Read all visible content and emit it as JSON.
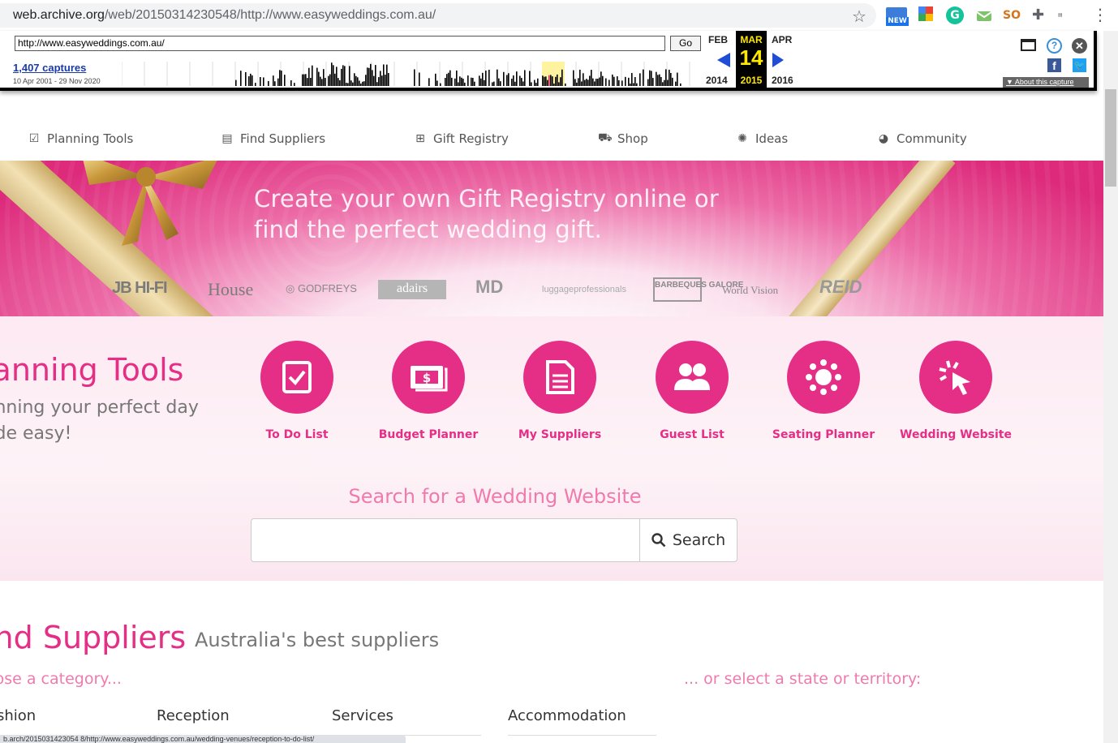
{
  "browser": {
    "url_host": "web.archive.org",
    "url_path": "/web/20150314230548/http://www.easyweddings.com.au/",
    "extensions": [
      "new-badge-icon",
      "google-icon",
      "grammarly-icon",
      "mail-icon",
      "so-icon",
      "puzzle-icon",
      "studio-icon"
    ],
    "new_badge": "NEW",
    "grammarly_letter": "G",
    "so_label": "SO"
  },
  "wayback": {
    "url_value": "http://www.easyweddings.com.au/",
    "go_label": "Go",
    "captures_label": "1,407 captures",
    "date_range": "10 Apr 2001 - 29 Nov 2020",
    "prev_month": "FEB",
    "current_month": "MAR",
    "next_month": "APR",
    "current_day": "14",
    "prev_year": "2014",
    "current_year": "2015",
    "next_year": "2016",
    "about_label": "About this capture",
    "help_glyph": "?",
    "close_glyph": "✕",
    "fb_glyph": "f",
    "tw_glyph": "🐦"
  },
  "nav": {
    "items": [
      {
        "label": "Planning Tools",
        "icon": "checkbox-icon"
      },
      {
        "label": "Find Suppliers",
        "icon": "document-icon"
      },
      {
        "label": "Gift Registry",
        "icon": "gift-icon"
      },
      {
        "label": "Shop",
        "icon": "cart-icon"
      },
      {
        "label": "Ideas",
        "icon": "lightbulb-icon"
      },
      {
        "label": "Community",
        "icon": "chat-icon"
      }
    ]
  },
  "hero": {
    "line1": "Create your own Gift Registry online or",
    "line2": "find the perfect wedding gift.",
    "logos": {
      "jb": "JB HI-FI",
      "house": "House",
      "godfreys": "◎ GODFREYS",
      "adairs": "adairs",
      "md": "MD",
      "luggage": "luggageprofessionals",
      "bbq": "BARBEQUES GALORE",
      "wv": "World Vision",
      "reid": "REID"
    }
  },
  "planning": {
    "title": "lanning Tools",
    "sub_line1": "anning your perfect day",
    "sub_line2": "ade easy!",
    "tools": [
      {
        "label": "To Do List",
        "icon": "todo-icon"
      },
      {
        "label": "Budget Planner",
        "icon": "budget-icon"
      },
      {
        "label": "My Suppliers",
        "icon": "suppliers-icon"
      },
      {
        "label": "Guest List",
        "icon": "guests-icon"
      },
      {
        "label": "Seating Planner",
        "icon": "seating-icon"
      },
      {
        "label": "Wedding Website",
        "icon": "website-icon"
      }
    ],
    "search_heading": "Search for a Wedding Website",
    "search_placeholder": "",
    "search_button": "Search"
  },
  "suppliers": {
    "title": "ind Suppliers",
    "subtitle": "Australia's best suppliers",
    "category_prompt": "oose a category...",
    "state_prompt": "... or select a state or territory:",
    "columns": [
      "shion",
      "Reception",
      "Services",
      "Accommodation"
    ]
  },
  "status_bar": "b.arch/2015031423054 8/http://www.easyweddings.com.au/wedding-venues/reception-to-do-list/"
}
